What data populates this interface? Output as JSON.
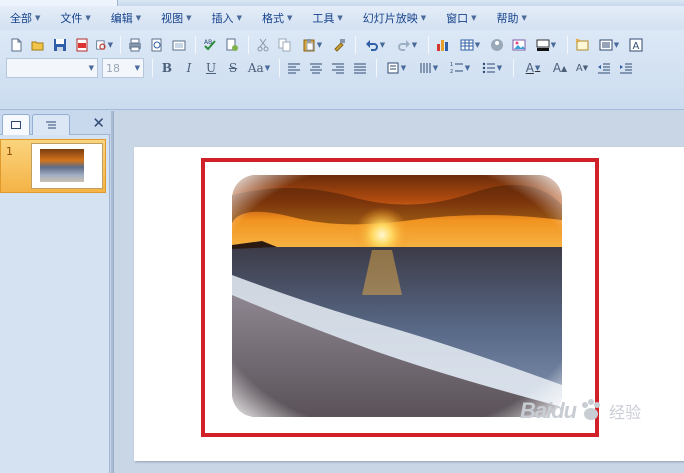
{
  "menu": {
    "items": [
      {
        "label": "全部"
      },
      {
        "label": "文件"
      },
      {
        "label": "编辑"
      },
      {
        "label": "视图"
      },
      {
        "label": "插入"
      },
      {
        "label": "格式"
      },
      {
        "label": "工具"
      },
      {
        "label": "幻灯片放映"
      },
      {
        "label": "窗口"
      },
      {
        "label": "帮助"
      }
    ]
  },
  "format_bar": {
    "font_name": "",
    "font_size": "18",
    "bold_label": "B",
    "italic_label": "I",
    "underline_label": "U",
    "shadow_label": "S",
    "case_label": "Aa",
    "font_color_label": "A",
    "grow_label": "A",
    "shrink_label": "A"
  },
  "slides_panel": {
    "close_glyph": "✕",
    "slides": [
      {
        "number": "1"
      }
    ]
  },
  "watermark": {
    "brand": "Baidu",
    "text": "经验"
  },
  "colors": {
    "frame_red": "#d02128",
    "selection_orange": "#f4b346",
    "toolbar_blue": "#cbdcef"
  }
}
